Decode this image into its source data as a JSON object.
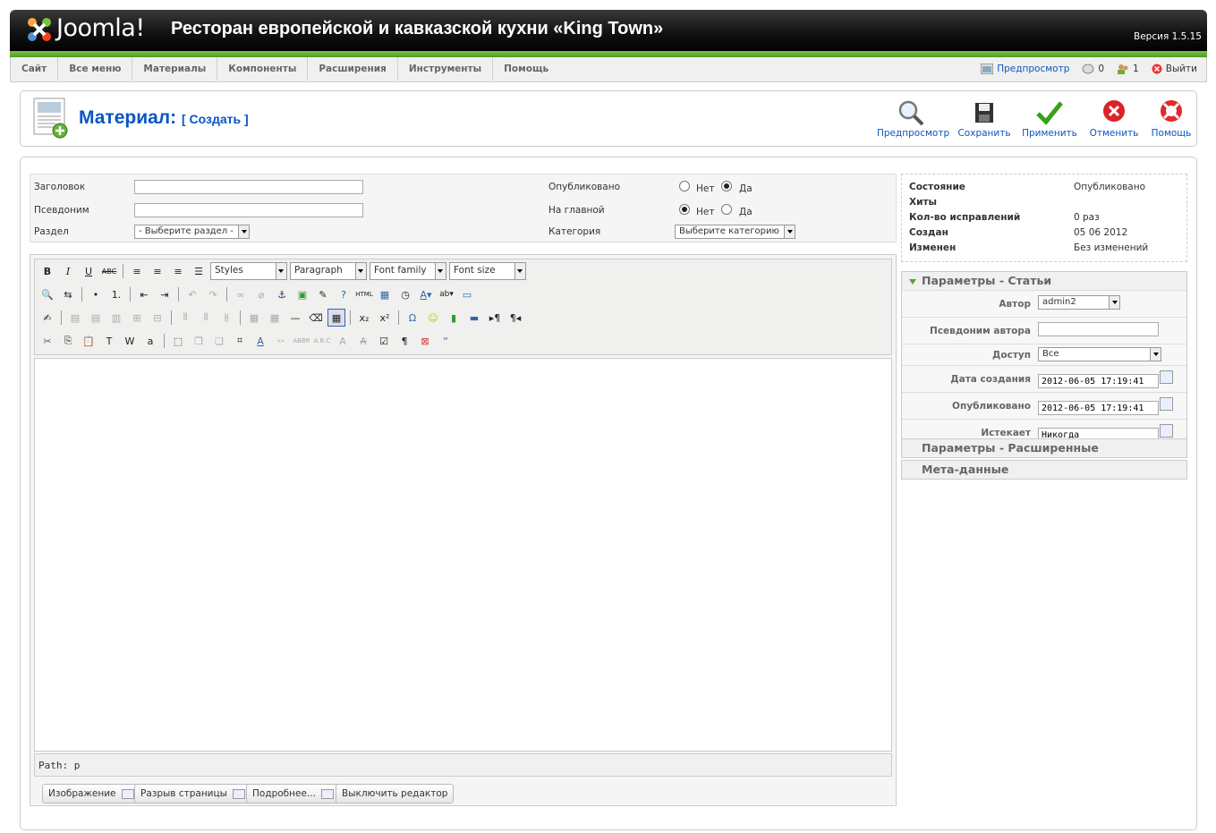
{
  "header": {
    "logo_text": "Joomla!",
    "site_title": "Ресторан европейской и кавказской кухни «King Town»",
    "version": "Версия 1.5.15"
  },
  "menu": {
    "items": [
      "Сайт",
      "Все меню",
      "Материалы",
      "Компоненты",
      "Расширения",
      "Инструменты",
      "Помощь"
    ]
  },
  "status": {
    "preview": "Предпросмотр",
    "messages": "0",
    "users": "1",
    "logout": "Выйти"
  },
  "toolbar": {
    "title": "Материал:",
    "subtitle": "[ Создать ]",
    "buttons": [
      "Предпросмотр",
      "Сохранить",
      "Применить",
      "Отменить",
      "Помощь"
    ]
  },
  "form": {
    "title_label": "Заголовок",
    "title_value": "",
    "alias_label": "Псевдоним",
    "alias_value": "",
    "section_label": "Раздел",
    "section_value": "- Выберите раздел -",
    "published_label": "Опубликовано",
    "frontpage_label": "На главной",
    "no": "Нет",
    "yes": "Да",
    "published": "yes",
    "frontpage": "no",
    "category_label": "Категория",
    "category_value": "Выберите категорию"
  },
  "editor": {
    "styles": "Styles",
    "format": "Paragraph",
    "font_family": "Font family",
    "font_size": "Font size",
    "path": "Path: p",
    "buttons": [
      "Изображение",
      "Разрыв страницы",
      "Подробнее...",
      "Выключить редактор"
    ]
  },
  "info": {
    "rows": [
      {
        "label": "Состояние",
        "value": "Опубликовано"
      },
      {
        "label": "Хиты",
        "value": ""
      },
      {
        "label": "Кол-во исправлений",
        "value": "0 раз"
      },
      {
        "label": "Создан",
        "value": "05 06 2012"
      },
      {
        "label": "Изменен",
        "value": "Без изменений"
      }
    ]
  },
  "params": {
    "title": "Параметры - Статьи",
    "author_label": "Автор",
    "author_value": "admin2",
    "alias_label": "Псевдоним автора",
    "alias_value": "",
    "access_label": "Доступ",
    "access_value": "Все",
    "created_label": "Дата создания",
    "created_value": "2012-06-05 17:19:41",
    "publish_label": "Опубликовано",
    "publish_value": "2012-06-05 17:19:41",
    "expires_label": "Истекает",
    "expires_value": "Никогда"
  },
  "panels": {
    "advanced": "Параметры - Расширенные",
    "meta": "Мета-данные"
  },
  "colors": {
    "link": "#0b55c4",
    "green": "#5a9f2a",
    "header": "#111111"
  }
}
